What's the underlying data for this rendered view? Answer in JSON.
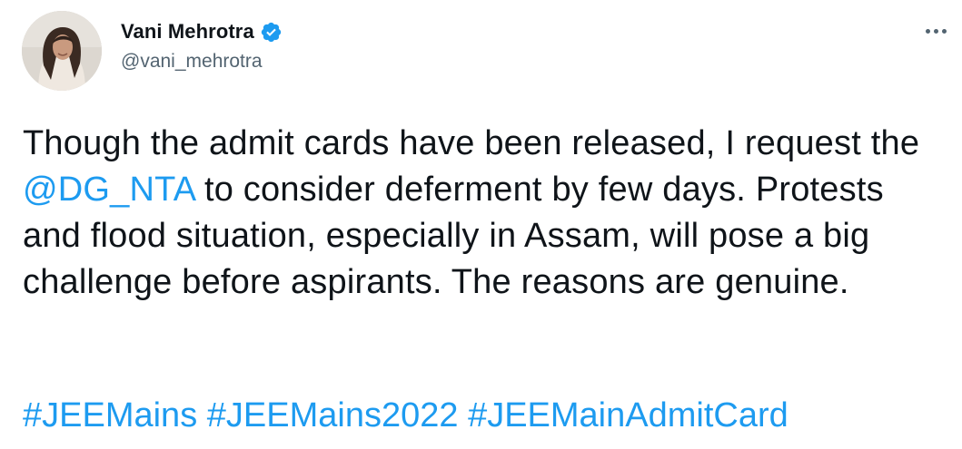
{
  "tweet": {
    "author": {
      "display_name": "Vani Mehrotra",
      "handle": "@vani_mehrotra",
      "verified": true,
      "verified_icon": "verified-badge-icon"
    },
    "text": {
      "part1": "Though the admit cards have been released, I request the ",
      "mention": "@DG_NTA",
      "part2": " to consider deferment by few days. Protests and flood situation, especially in Assam, will pose a big challenge before aspirants. The reasons are genuine."
    },
    "hashtags": [
      "#JEEMains",
      "#JEEMains2022",
      "#JEEMainAdmitCard"
    ],
    "more_icon": "more-options-icon"
  },
  "colors": {
    "link": "#1d9bf0",
    "text": "#0f1419",
    "secondary": "#536471"
  }
}
